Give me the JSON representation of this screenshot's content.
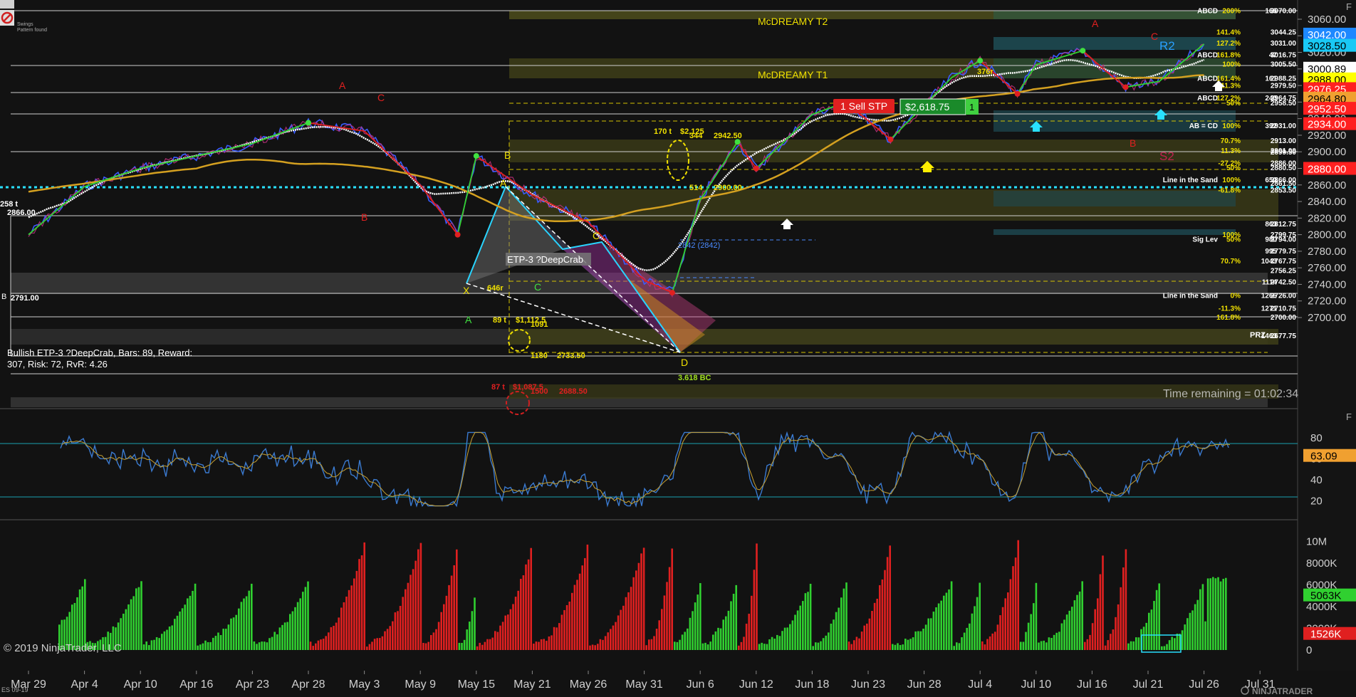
{
  "app": {
    "copyright": "© 2019 NinjaTrader, LLC",
    "brand": "NINJATRADER",
    "instrument": "ES 09-19",
    "legend_top_1": "Swings",
    "legend_top_2": "Pattern found",
    "time_remaining": "Time remaining = 01:02:34",
    "corner_label_f1": "F",
    "corner_label_f2": "F"
  },
  "pattern_info": {
    "line1": "Bullish ETP-3 ?DeepCrab, Bars: 89, Reward:",
    "line2": "307, Risk: 72, RvR: 4.26",
    "pattern_label": "ETP-3 ?DeepCrab"
  },
  "zones": {
    "t2": "McDREAMY T2",
    "t1": "McDREAMY T1"
  },
  "orders": {
    "sell_stp": "1 Sell STP",
    "pnl": "$2,618.75",
    "qty": "1"
  },
  "price_axis": {
    "ticks": [
      "3060.00",
      "3040.00",
      "3020.00",
      "3000.00",
      "2980.00",
      "2960.00",
      "2940.00",
      "2920.00",
      "2900.00",
      "2880.00",
      "2860.00",
      "2840.00",
      "2820.00",
      "2800.00",
      "2780.00",
      "2760.00",
      "2740.00",
      "2720.00",
      "2700.00"
    ],
    "badges": [
      {
        "text": "3042.00",
        "bg": "#1e88ff",
        "fg": "#ffffff"
      },
      {
        "text": "3028.50",
        "bg": "#19c9f5",
        "fg": "#000000"
      },
      {
        "text": "3000.89",
        "bg": "#ffffff",
        "fg": "#000000"
      },
      {
        "text": "2988.00",
        "bg": "#ffff00",
        "fg": "#000000"
      },
      {
        "text": "2976.25",
        "bg": "#ff2020",
        "fg": "#ffffff"
      },
      {
        "text": "2964.80",
        "bg": "#f0a030",
        "fg": "#000000"
      },
      {
        "text": "2952.50",
        "bg": "#ff2020",
        "fg": "#ffffff"
      },
      {
        "text": "2934.00",
        "bg": "#ff2020",
        "fg": "#ffffff"
      },
      {
        "text": "2880.00",
        "bg": "#ff2020",
        "fg": "#ffffff"
      }
    ]
  },
  "right_labels": [
    {
      "a": "ABCD",
      "b": "200%",
      "c": "166",
      "d": "3070.00"
    },
    {
      "a": "",
      "b": "141.4%",
      "c": "",
      "d": "3044.25"
    },
    {
      "a": "",
      "b": "127.2%",
      "c": "",
      "d": "3031.00"
    },
    {
      "a": "ABCD",
      "b": "161.8%",
      "c": "47",
      "d": "3016.75"
    },
    {
      "a": "",
      "b": "100%",
      "c": "",
      "d": "3005.50"
    },
    {
      "a": "ABCD",
      "b": "161.4%",
      "c": "161",
      "d": "2988.25"
    },
    {
      "a": "",
      "b": "11.3%",
      "c": "",
      "d": "2979.50"
    },
    {
      "a": "ABCD",
      "b": "127.2%",
      "c": "240",
      "d": "2964.75"
    },
    {
      "a": "",
      "b": "50%",
      "c": "",
      "d": "2958.50"
    },
    {
      "a": "AB = CD",
      "b": "100%",
      "c": "392",
      "d": "2931.00"
    },
    {
      "a": "",
      "b": "70.7%",
      "c": "",
      "d": "2913.00"
    },
    {
      "a": "",
      "b": "11.3%",
      "c": "",
      "d": "2901.00"
    },
    {
      "a": "",
      "b": "",
      "c": "",
      "d": "2899.50"
    },
    {
      "a": "",
      "b": "-27.2%",
      "c": "",
      "d": "2886.00"
    },
    {
      "a": "",
      "b": "50%",
      "c": "",
      "d": "2880.50"
    },
    {
      "a": "Line in the Sand",
      "b": "100%",
      "c": "650",
      "d": "2866.00"
    },
    {
      "a": "",
      "b": "",
      "c": "",
      "d": "2861.50"
    },
    {
      "a": "",
      "b": "-61.8%",
      "c": "",
      "d": "2853.50"
    },
    {
      "a": "",
      "b": "",
      "c": "863",
      "d": "2812.75"
    },
    {
      "a": "",
      "b": "100%",
      "c": "",
      "d": "2799.75"
    },
    {
      "a": "Sig Lev",
      "b": "50%",
      "c": "980",
      "d": "2794.00"
    },
    {
      "a": "",
      "b": "",
      "c": "995",
      "d": "2779.75"
    },
    {
      "a": "",
      "b": "70.7%",
      "c": "1043",
      "d": "2767.75"
    },
    {
      "a": "",
      "b": "",
      "c": "",
      "d": "2756.25"
    },
    {
      "a": "",
      "b": "",
      "c": "1114",
      "d": "2742.50"
    },
    {
      "a": "Line in the Sand",
      "b": "0%",
      "c": "1266",
      "d": "2726.00"
    },
    {
      "a": "",
      "b": "-11.3%",
      "c": "1271",
      "d": "2710.75"
    },
    {
      "a": "",
      "b": "161.8%",
      "c": "",
      "d": "2700.00"
    },
    {
      "a": "",
      "b": "",
      "c": "1463",
      "d": "2677.75"
    }
  ],
  "chart_labels": {
    "t170": "170 t",
    "d2125": "$2,125",
    "n344": "344",
    "p294250": "2942.50",
    "t89": "89 t",
    "d1112": "$1,112.5",
    "n1091": "1091",
    "n1180": "1180",
    "p273350": "2733.50",
    "t87": "87 t",
    "d1087": "$1,087.5",
    "n1500": "1500",
    "p268850": "2688.50",
    "n514": "514",
    "p2900": "2900.00",
    "p2842": "2842 (2842)",
    "bc3618": "3.618 BC",
    "t258": "258 t",
    "p2866": "2866.00",
    "p2791": "2791.00",
    "x646": "646r",
    "x376": "376r",
    "prz": "PRZ",
    "r2": "R2",
    "s2": "S2"
  },
  "pattern_points": {
    "X": "X",
    "A": "A",
    "B": "B",
    "C": "C",
    "D": "D"
  },
  "wave_labels": {
    "A1": "A",
    "C1": "C",
    "B1": "B",
    "A2": "A",
    "C2": "C",
    "B2": "B",
    "B3": "B",
    "A3": "A",
    "C3": "C"
  },
  "rsi_axis": {
    "ticks": [
      "80",
      "60",
      "40",
      "20"
    ],
    "badge": "63.09"
  },
  "vol_axis": {
    "ticks": [
      "10M",
      "8000K",
      "6000K",
      "4000K",
      "2000K",
      "0"
    ],
    "badge_green": "5063K",
    "badge_red": "1526K"
  },
  "dates": [
    "Mar 29",
    "Apr 4",
    "Apr 10",
    "Apr 16",
    "Apr 23",
    "Apr 28",
    "May 3",
    "May 9",
    "May 15",
    "May 21",
    "May 26",
    "May 31",
    "Jun 6",
    "Jun 12",
    "Jun 18",
    "Jun 23",
    "Jun 28",
    "Jul 4",
    "Jul 10",
    "Jul 16",
    "Jul 21",
    "Jul 26",
    "Jul 31"
  ],
  "chart_data": {
    "type": "line",
    "title": "",
    "instrument": "ES 09-19",
    "y_range": [
      2690,
      3070
    ],
    "price_series": {
      "x": [
        "Mar 29",
        "Apr 4",
        "Apr 10",
        "Apr 16",
        "Apr 23",
        "Apr 28",
        "May 3",
        "May 9",
        "May 13",
        "May 15",
        "May 21",
        "May 26",
        "May 31",
        "Jun 3",
        "Jun 6",
        "Jun 10",
        "Jun 12",
        "Jun 18",
        "Jun 21",
        "Jun 25",
        "Jul 1",
        "Jul 4",
        "Jul 8",
        "Jul 10",
        "Jul 15",
        "Jul 17",
        "Jul 19",
        "Jul 22",
        "Jul 26"
      ],
      "y": [
        2800,
        2858,
        2880,
        2895,
        2910,
        2935,
        2925,
        2860,
        2800,
        2895,
        2848,
        2815,
        2745,
        2730,
        2842,
        2912,
        2880,
        2945,
        2960,
        2915,
        2990,
        3010,
        2970,
        3005,
        3022,
        3000,
        2978,
        2985,
        3030
      ]
    },
    "rsi": {
      "y_range": [
        10,
        90
      ],
      "last": 63.09
    },
    "volume": {
      "y_range_k": [
        0,
        11000
      ],
      "last_up": 5063,
      "last_down": 1526
    }
  }
}
